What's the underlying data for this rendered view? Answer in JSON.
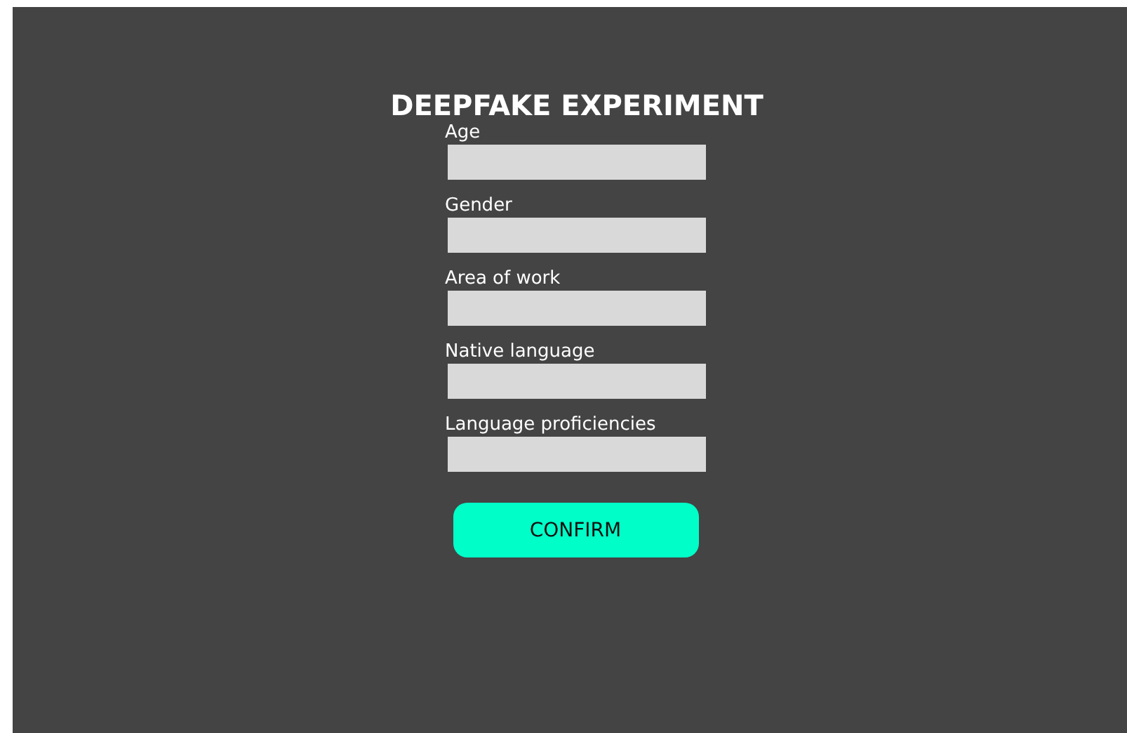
{
  "title": "DEEPFAKE EXPERIMENT",
  "fields": [
    {
      "label": "Age"
    },
    {
      "label": "Gender"
    },
    {
      "label": "Area of work"
    },
    {
      "label": "Native language"
    },
    {
      "label": "Language proficiencies"
    }
  ],
  "button": "CONFIRM"
}
